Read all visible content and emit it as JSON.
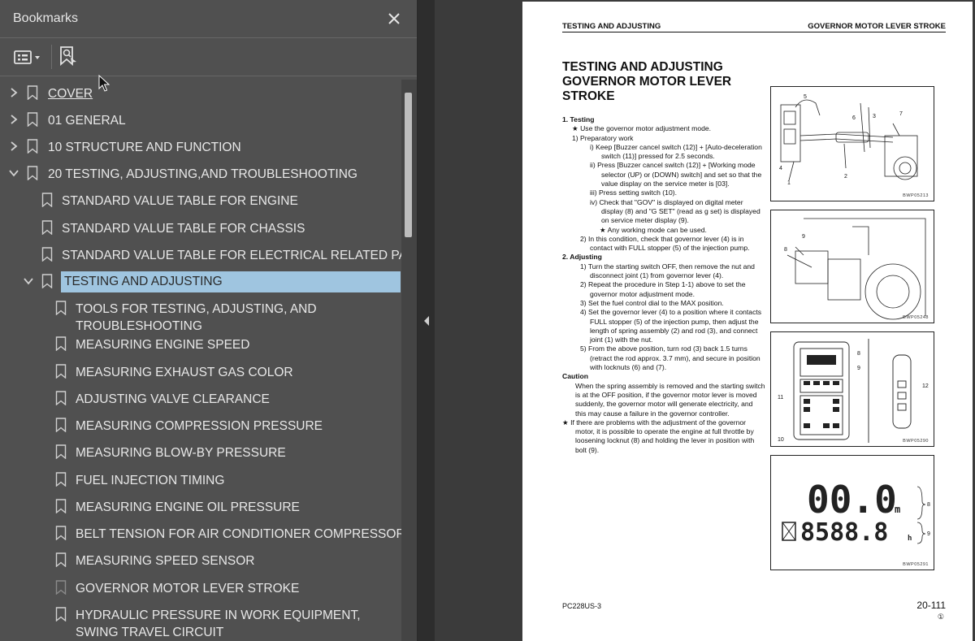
{
  "panel": {
    "title": "Bookmarks",
    "icons": {
      "close": "close-icon",
      "options": "list-options-icon",
      "find": "find-bookmark-icon"
    }
  },
  "bookmarks": [
    {
      "label": "COVER",
      "level": 0,
      "expand": "collapsed",
      "underline": true
    },
    {
      "label": "01 GENERAL",
      "level": 0,
      "expand": "collapsed"
    },
    {
      "label": "10 STRUCTURE AND FUNCTION",
      "level": 0,
      "expand": "collapsed"
    },
    {
      "label": "20 TESTING, ADJUSTING,AND TROUBLESHOOTING",
      "level": 0,
      "expand": "expanded"
    },
    {
      "label": "STANDARD VALUE TABLE FOR ENGINE",
      "level": 1
    },
    {
      "label": "STANDARD VALUE TABLE FOR CHASSIS",
      "level": 1
    },
    {
      "label": "STANDARD VALUE TABLE FOR ELECTRICAL RELATED PARTS",
      "level": 1
    },
    {
      "label": "TESTING AND ADJUSTING",
      "level": 1,
      "expand": "expanded",
      "selected": true
    },
    {
      "label": "TOOLS FOR TESTING, ADJUSTING, AND TROUBLESHOOTING",
      "level": 2
    },
    {
      "label": "MEASURING ENGINE SPEED",
      "level": 2
    },
    {
      "label": "MEASURING EXHAUST GAS COLOR",
      "level": 2
    },
    {
      "label": "ADJUSTING VALVE CLEARANCE",
      "level": 2
    },
    {
      "label": "MEASURING COMPRESSION PRESSURE",
      "level": 2
    },
    {
      "label": "MEASURING BLOW-BY PRESSURE",
      "level": 2
    },
    {
      "label": "FUEL INJECTION TIMING",
      "level": 2
    },
    {
      "label": "MEASURING ENGINE OIL PRESSURE",
      "level": 2
    },
    {
      "label": "BELT TENSION FOR AIR CONDITIONER COMPRESSOR",
      "level": 2
    },
    {
      "label": "MEASURING SPEED SENSOR",
      "level": 2
    },
    {
      "label": "GOVERNOR MOTOR LEVER STROKE",
      "level": 2,
      "current": true
    },
    {
      "label": "HYDRAULIC PRESSURE IN WORK EQUIPMENT, SWING TRAVEL CIRCUIT",
      "level": 2
    }
  ],
  "colors": {
    "selection": "#9fc5e0",
    "panel_bg": "#505050",
    "doc_bg": "#3b3b3b"
  },
  "document": {
    "header_left": "TESTING AND ADJUSTING",
    "header_right": "GOVERNOR MOTOR LEVER STROKE",
    "title": "TESTING AND ADJUSTING GOVERNOR MOTOR LEVER STROKE",
    "body": [
      {
        "cls": "b",
        "text": "1.  Testing"
      },
      {
        "cls": "i1",
        "text": "★  Use the governor motor adjustment mode."
      },
      {
        "cls": "i1",
        "text": "1)  Preparatory work"
      },
      {
        "cls": "i3",
        "text": "i)   Keep [Buzzer cancel switch (12)] + [Auto-deceleration switch (11)] pressed for 2.5 seconds."
      },
      {
        "cls": "i3",
        "text": "ii)  Press [Buzzer cancel switch (12)] + [Working mode selector (UP) or (DOWN) switch] and set so that the value display on the service meter is [03]."
      },
      {
        "cls": "i3",
        "text": "iii) Press setting switch (10)."
      },
      {
        "cls": "i3",
        "text": "iv) Check that \"GOV\" is displayed on digital meter display (8) and \"G SET\" (read as g set) is displayed on service meter display (9)."
      },
      {
        "cls": "i4",
        "text": "★  Any working mode can be used."
      },
      {
        "cls": "i2",
        "text": "2)  In this condition, check that governor lever (4) is in contact with FULL stopper (5) of the injection pump."
      },
      {
        "cls": "b",
        "text": "2.  Adjusting"
      },
      {
        "cls": "i2",
        "text": "1)  Turn the starting switch OFF, then remove the nut and disconnect joint (1) from governor lever (4)."
      },
      {
        "cls": "i2",
        "text": "2)  Repeat the procedure in Step 1-1) above to set the governor motor adjustment mode."
      },
      {
        "cls": "i2",
        "text": "3)  Set the fuel control dial to the MAX position."
      },
      {
        "cls": "i2",
        "text": "4)  Set the governor lever (4) to a position where it contacts FULL stopper (5) of the injection pump, then adjust the length of spring assembly (2) and rod (3), and connect joint (1) with the nut."
      },
      {
        "cls": "i2",
        "text": "5)  From the above position, turn rod (3) back 1.5 turns (retract the rod approx. 3.7 mm), and secure in position with locknuts (6) and (7)."
      },
      {
        "cls": "b",
        "text": "Caution"
      },
      {
        "cls": "cap",
        "text": "When the spring assembly is removed and the starting switch is at the OFF position, if the governor motor lever is moved suddenly, the governor motor will generate electricity, and this may cause a failure in the governor controller."
      },
      {
        "cls": "star",
        "text": "★  If there are problems with the adjustment of the governor motor, it is possible to operate the engine at full throttle by loosening locknut (8) and holding the lever in position with bolt (9)."
      }
    ],
    "figures": [
      {
        "code": "BWP05213",
        "labels": [
          "5",
          "6",
          "3",
          "7",
          "4",
          "1",
          "2"
        ]
      },
      {
        "code": "BWP05248",
        "labels": [
          "8",
          "9"
        ]
      },
      {
        "code": "BWP05290",
        "labels": [
          "8",
          "9",
          "11",
          "12",
          "10"
        ]
      },
      {
        "code": "BWP05291",
        "display_top": "00.0",
        "display_bottom": "8588.8",
        "unit_top": "m",
        "unit_bottom": "h",
        "labels": [
          "8",
          "9"
        ]
      }
    ],
    "footer_model": "PC228US-3",
    "footer_page": "20-111",
    "footer_rev": "①"
  }
}
